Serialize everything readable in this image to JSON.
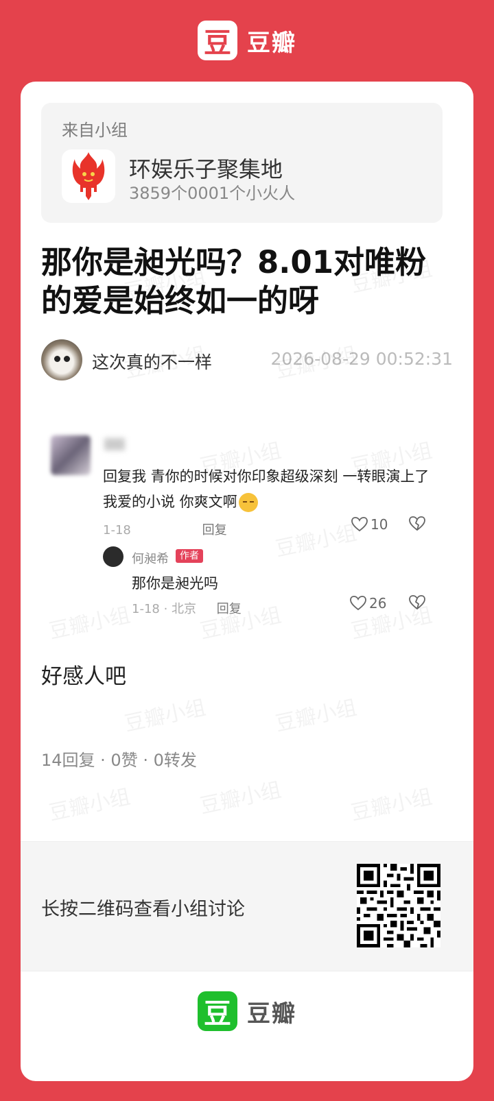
{
  "brand": {
    "logo_char": "豆",
    "name": "豆瓣"
  },
  "group": {
    "from_label": "来自小组",
    "name": "环娱乐子聚集地",
    "members": "3859个0001个小火人"
  },
  "post": {
    "title": "那你是昶光吗？8.01对唯粉的爱是始终如一的呀",
    "author": "这次真的不一样",
    "time": "2026-08-29 00:52:31",
    "body": "好感人吧"
  },
  "screenshot": {
    "comment": {
      "text": "回复我 青你的时候对你印象超级深刻 一转眼演上了我爱的小说 你爽文啊",
      "date": "1-18",
      "reply_label": "回复",
      "likes": "10"
    },
    "reply": {
      "name": "何昶希",
      "tag": "作者",
      "text": "那你是昶光吗",
      "meta": "1-18 · 北京",
      "reply_label": "回复",
      "likes": "26"
    }
  },
  "stats": "14回复 · 0赞 · 0转发",
  "qr_text": "长按二维码查看小组讨论",
  "watermark_text": "豆瓣小组",
  "colors": {
    "background": "#e4424c",
    "douban_green": "#1fbf2d",
    "author_tag": "#e4425a"
  }
}
